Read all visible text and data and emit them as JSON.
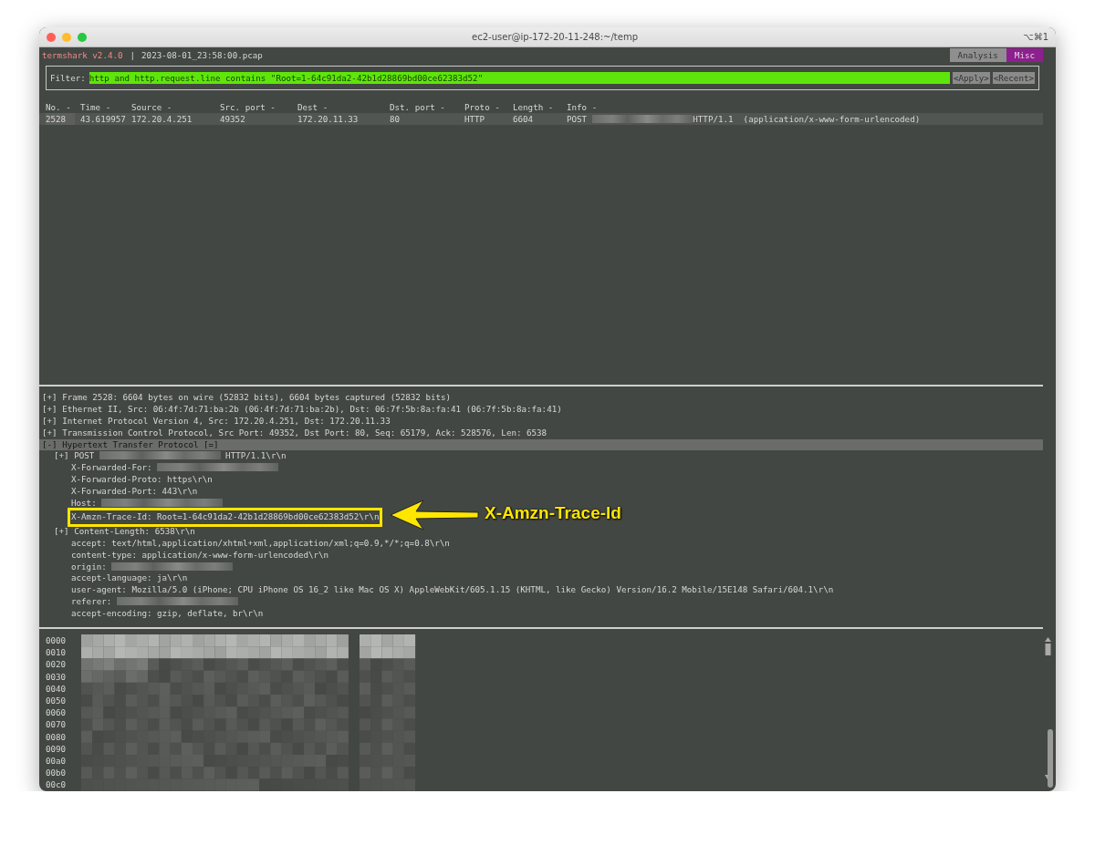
{
  "window": {
    "title": "ec2-user@ip-172-20-11-248:~/temp",
    "shortcut": "⌥⌘1"
  },
  "header": {
    "app": "termshark v2.4.0",
    "separator": "|",
    "file": "2023-08-01_23:58:00.pcap"
  },
  "tabs": [
    {
      "label": "Analysis",
      "selected": false
    },
    {
      "label": "Misc",
      "selected": true
    }
  ],
  "filter": {
    "label": "Filter:",
    "value": "http and http.request.line contains \"Root=1-64c91da2-42b1d28869bd00ce62383d52\"",
    "valid": true,
    "buttons": [
      "<Apply>",
      "<Recent>"
    ]
  },
  "packet_list": {
    "columns": [
      "No. -",
      "Time -",
      "Source -",
      "Src. port -",
      "Dest -",
      "Dst. port -",
      "Proto -",
      "Length -",
      "Info -"
    ],
    "rows": [
      {
        "selected": true,
        "cells": [
          "2528",
          "43.619957",
          "172.20.4.251",
          "49352",
          "172.20.11.33",
          "80",
          "HTTP",
          "6604"
        ],
        "info": {
          "text": "POST",
          "redacted": true,
          "text_after": "HTTP/1.1  (application/x-www-form-urlencoded)"
        }
      }
    ]
  },
  "tree": [
    {
      "marker": "[+]",
      "label": "Frame 2528: 6604 bytes on wire (52832 bits), 6604 bytes captured (52832 bits)",
      "selected": false
    },
    {
      "marker": "[+]",
      "label": "Ethernet II, Src: 06:4f:7d:71:ba:2b (06:4f:7d:71:ba:2b), Dst: 06:7f:5b:8a:fa:41 (06:7f:5b:8a:fa:41)",
      "selected": false
    },
    {
      "marker": "[+]",
      "label": "Internet Protocol Version 4, Src: 172.20.4.251, Dst: 172.20.11.33",
      "selected": false
    },
    {
      "marker": "[+]",
      "label": "Transmission Control Protocol, Src Port: 49352, Dst Port: 80, Seq: 65179, Ack: 528576, Len: 6538",
      "selected": false
    },
    {
      "marker": "[-]",
      "label": "Hypertext Transfer Protocol [=]",
      "selected": true,
      "children": [
        {
          "marker": "[+]",
          "label": "POST",
          "redacted": true,
          "text_after": "HTTP/1.1\\r\\n",
          "selected": false
        },
        {
          "label": "X-Forwarded-For:",
          "redacted": true,
          "selected": false
        },
        {
          "label": "X-Forwarded-Proto: https\\r\\n",
          "selected": false
        },
        {
          "label": "X-Forwarded-Port: 443\\r\\n",
          "selected": false
        },
        {
          "label": "Host:",
          "redacted": true,
          "selected": false
        },
        {
          "label": "X-Amzn-Trace-Id: Root=1-64c91da2-42b1d28869bd00ce62383d52\\r\\n",
          "selected": false,
          "annotated": true
        },
        {
          "marker": "[+]",
          "label": "Content-Length: 6538\\r\\n",
          "selected": false
        },
        {
          "label": "accept: text/html,application/xhtml+xml,application/xml;q=0.9,*/*;q=0.8\\r\\n",
          "selected": false
        },
        {
          "label": "content-type: application/x-www-form-urlencoded\\r\\n",
          "selected": false
        },
        {
          "label": "origin:",
          "redacted": true,
          "selected": false
        },
        {
          "label": "accept-language: ja\\r\\n",
          "selected": false
        },
        {
          "label": "user-agent: Mozilla/5.0 (iPhone; CPU iPhone OS 16_2 like Mac OS X) AppleWebKit/605.1.15 (KHTML, like Gecko) Version/16.2 Mobile/15E148 Safari/604.1\\r\\n",
          "selected": false
        },
        {
          "label": "referer:",
          "redacted": true,
          "selected": false
        },
        {
          "label": "accept-encoding: gzip, deflate, br\\r\\n",
          "selected": false
        }
      ]
    }
  ],
  "annotation": {
    "label": "X-Amzn-Trace-Id"
  },
  "hex": {
    "offsets": [
      "0000",
      "0010",
      "0020",
      "0030",
      "0040",
      "0050",
      "0060",
      "0070",
      "0080",
      "0090",
      "00a0",
      "00b0",
      "00c0"
    ],
    "redacted": true
  }
}
